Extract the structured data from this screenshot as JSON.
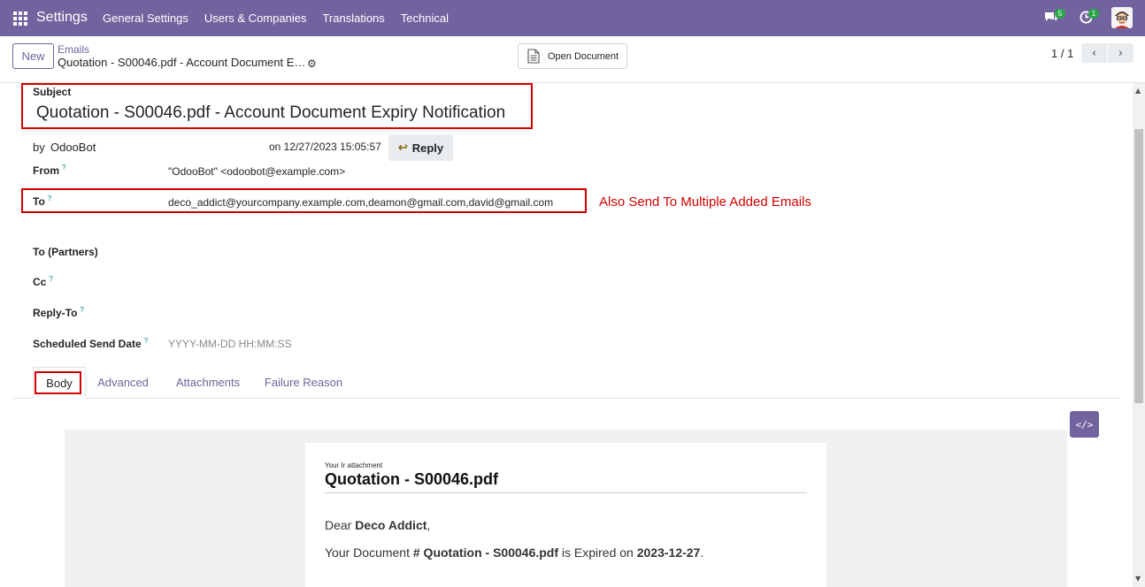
{
  "navbar": {
    "brand": "Settings",
    "menu": [
      "General Settings",
      "Users & Companies",
      "Translations",
      "Technical"
    ],
    "chat_count": "5",
    "activity_count": "1",
    "bg_color": "#71639e"
  },
  "control_panel": {
    "new_label": "New",
    "breadcrumb_parent": "Emails",
    "breadcrumb_current": "Quotation - S00046.pdf - Account Document E…",
    "open_document_label": "Open Document",
    "pager": "1 / 1"
  },
  "form": {
    "subject_label": "Subject",
    "subject_value": "Quotation - S00046.pdf - Account Document Expiry Notification",
    "by_prefix": "by",
    "author": "OdooBot",
    "date_text": "on 12/27/2023 15:05:57",
    "reply_label": "Reply",
    "from_label": "From",
    "from_value": "\"OdooBot\" <odoobot@example.com>",
    "to_label": "To",
    "to_value": "deco_addict@yourcompany.example.com,deamon@gmail.com,david@gmail.com",
    "annotation": "Also Send To Multiple Added Emails",
    "to_partners_label": "To (Partners)",
    "cc_label": "Cc",
    "reply_to_label": "Reply-To",
    "scheduled_label": "Scheduled Send Date",
    "scheduled_placeholder": "YYYY-MM-DD HH:MM:SS",
    "help_mark": "?"
  },
  "tabs": [
    "Body",
    "Advanced",
    "Attachments",
    "Failure Reason"
  ],
  "email_body": {
    "small_heading": "Your Ir attachment",
    "title": "Quotation - S00046.pdf",
    "greeting_prefix": "Dear ",
    "greeting_name": "Deco Addict",
    "greeting_suffix": ",",
    "line_prefix": "Your Document ",
    "line_doc": "# Quotation - S00046.pdf",
    "line_mid": " is Expired on ",
    "line_date": "2023-12-27",
    "line_suffix": "."
  },
  "colors": {
    "accent": "#71639e",
    "highlight": "#d00000"
  }
}
